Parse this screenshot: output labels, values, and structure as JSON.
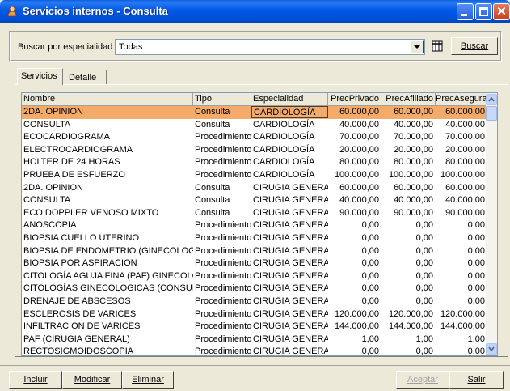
{
  "window": {
    "title": "Servicios internos - Consulta"
  },
  "search": {
    "label": "Buscar por especialidad",
    "value": "Todas",
    "button": "Buscar"
  },
  "tabs": [
    {
      "label": "Servicios"
    },
    {
      "label": "Detalle"
    }
  ],
  "grid": {
    "columns": [
      "Nombre",
      "Tipo",
      "Especialidad",
      "PrecPrivado",
      "PrecAfiliado",
      "PrecAsegurado"
    ],
    "selected_row": 0,
    "rows": [
      [
        "2DA. OPINION",
        "Consulta",
        "CARDIOLOGÍA",
        "60.000,00",
        "60.000,00",
        "60.000,00"
      ],
      [
        "CONSULTA",
        "Consulta",
        "CARDIOLOGÍA",
        "40.000,00",
        "40.000,00",
        "40.000,00"
      ],
      [
        "ECOCARDIOGRAMA",
        "Procedimiento",
        "CARDIOLOGÍA",
        "70.000,00",
        "70.000,00",
        "70.000,00"
      ],
      [
        "ELECTROCARDIOGRAMA",
        "Procedimiento",
        "CARDIOLOGÍA",
        "20.000,00",
        "20.000,00",
        "20.000,00"
      ],
      [
        "HOLTER DE 24 HORAS",
        "Procedimiento",
        "CARDIOLOGÍA",
        "80.000,00",
        "80.000,00",
        "80.000,00"
      ],
      [
        "PRUEBA DE ESFUERZO",
        "Procedimiento",
        "CARDIOLOGÍA",
        "100.000,00",
        "100.000,00",
        "100.000,00"
      ],
      [
        "2DA. OPINION",
        "Consulta",
        "CIRUGIA GENERAL",
        "60.000,00",
        "60.000,00",
        "60.000,00"
      ],
      [
        "CONSULTA",
        "Consulta",
        "CIRUGIA GENERAL",
        "40.000,00",
        "40.000,00",
        "40.000,00"
      ],
      [
        "ECO DOPPLER VENOSO MIXTO",
        "Consulta",
        "CIRUGIA GENERAL",
        "90.000,00",
        "90.000,00",
        "90.000,00"
      ],
      [
        "ANOSCOPIA",
        "Procedimiento",
        "CIRUGIA GENERAL",
        "0,00",
        "0,00",
        "0,00"
      ],
      [
        "BIOPSIA CUELLO UTERINO",
        "Procedimiento",
        "CIRUGIA GENERAL",
        "0,00",
        "0,00",
        "0,00"
      ],
      [
        "BIOPSIA DE ENDOMETRIO (GINECOLOGICA)",
        "Procedimiento",
        "CIRUGIA GENERAL",
        "0,00",
        "0,00",
        "0,00"
      ],
      [
        "BIOPSIA POR ASPIRACION",
        "Procedimiento",
        "CIRUGIA GENERAL",
        "0,00",
        "0,00",
        "0,00"
      ],
      [
        "CITOLOGÍA AGUJA FINA (PAF) GINECOLOGICA",
        "Procedimiento",
        "CIRUGIA GENERAL",
        "0,00",
        "0,00",
        "0,00"
      ],
      [
        "CITOLOGÍAS GINECOLOGICAS (CONSULTA)",
        "Procedimiento",
        "CIRUGIA GENERAL",
        "0,00",
        "0,00",
        "0,00"
      ],
      [
        "DRENAJE DE ABSCESOS",
        "Procedimiento",
        "CIRUGIA GENERAL",
        "0,00",
        "0,00",
        "0,00"
      ],
      [
        "ESCLEROSIS DE VARICES",
        "Procedimiento",
        "CIRUGIA GENERAL",
        "120.000,00",
        "120.000,00",
        "120.000,00"
      ],
      [
        "INFILTRACION DE VARICES",
        "Procedimiento",
        "CIRUGIA GENERAL",
        "144.000,00",
        "144.000,00",
        "144.000,00"
      ],
      [
        "PAF (CIRUGIA GENERAL)",
        "Procedimiento",
        "CIRUGIA GENERAL",
        "1,00",
        "1,00",
        "1,00"
      ],
      [
        "RECTOSIGMOIDOSCOPIA",
        "Procedimiento",
        "CIRUGIA GENERAL",
        "0,00",
        "0,00",
        "0,00"
      ]
    ]
  },
  "buttons": {
    "incluir": "Incluir",
    "modificar": "Modificar",
    "eliminar": "Eliminar",
    "aceptar": "Aceptar",
    "salir": "Salir"
  },
  "colors": {
    "selection": "#f4aa68",
    "titlebar": "#0058e6",
    "window_bg": "#ece9d8"
  },
  "icons": {
    "app": "person-icon",
    "grid": "table-grid-icon"
  }
}
